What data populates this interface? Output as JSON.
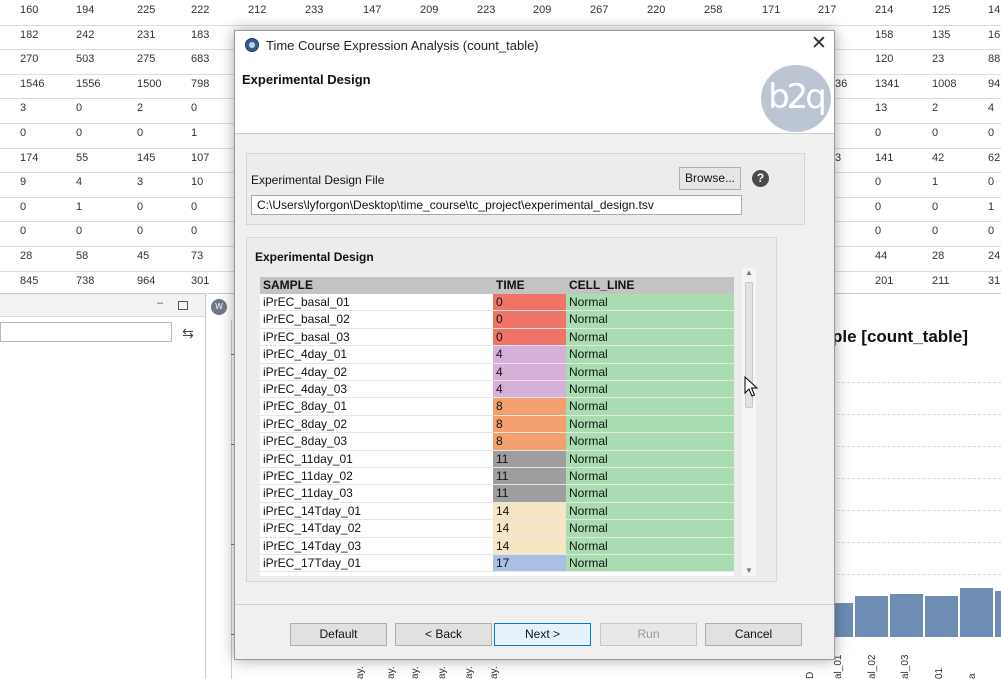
{
  "background_table": {
    "rows": [
      [
        "160",
        "194",
        "225",
        "222",
        "212",
        "233",
        "147",
        "209",
        "223",
        "209",
        "267",
        "220",
        "258",
        "171",
        "217",
        "",
        "214",
        "125",
        "14"
      ],
      [
        "182",
        "242",
        "231",
        "183",
        "",
        "",
        "",
        "",
        "",
        "",
        "",
        "",
        "",
        "",
        "",
        "",
        "158",
        "135",
        "16"
      ],
      [
        "270",
        "503",
        "275",
        "683",
        "",
        "",
        "",
        "",
        "",
        "",
        "",
        "",
        "",
        "",
        "",
        "",
        "120",
        "23",
        "88"
      ],
      [
        "1546",
        "1556",
        "1500",
        "798",
        "",
        "",
        "",
        "",
        "",
        "",
        "",
        "",
        "",
        "",
        "",
        "36",
        "1341",
        "1008",
        "94"
      ],
      [
        "3",
        "0",
        "2",
        "0",
        "",
        "",
        "",
        "",
        "",
        "",
        "",
        "",
        "",
        "",
        "",
        "",
        "13",
        "2",
        "4"
      ],
      [
        "0",
        "0",
        "0",
        "1",
        "",
        "",
        "",
        "",
        "",
        "",
        "",
        "",
        "",
        "",
        "",
        "",
        "0",
        "0",
        "0"
      ],
      [
        "174",
        "55",
        "145",
        "107",
        "",
        "",
        "",
        "",
        "",
        "",
        "",
        "",
        "",
        "",
        "",
        "3",
        "141",
        "42",
        "62"
      ],
      [
        "9",
        "4",
        "3",
        "10",
        "",
        "",
        "",
        "",
        "",
        "",
        "",
        "",
        "",
        "",
        "",
        "",
        "0",
        "1",
        "0"
      ],
      [
        "0",
        "1",
        "0",
        "0",
        "",
        "",
        "",
        "",
        "",
        "",
        "",
        "",
        "",
        "",
        "",
        "",
        "0",
        "0",
        "1"
      ],
      [
        "0",
        "0",
        "0",
        "0",
        "",
        "",
        "",
        "",
        "",
        "",
        "",
        "",
        "",
        "",
        "",
        "",
        "0",
        "0",
        "0"
      ],
      [
        "28",
        "58",
        "45",
        "73",
        "",
        "",
        "",
        "",
        "",
        "",
        "",
        "",
        "",
        "",
        "",
        "",
        "44",
        "28",
        "24"
      ],
      [
        "845",
        "738",
        "964",
        "301",
        "",
        "",
        "",
        "",
        "",
        "",
        "",
        "",
        "",
        "",
        "",
        "",
        "201",
        "211",
        "31"
      ]
    ]
  },
  "left_panel": {
    "minimize_glyph": "–"
  },
  "chart_panel": {
    "tab_icon_text": "W",
    "title_fragment": "ple [count_table]",
    "bar_color": "#6d8db5",
    "bars": [
      0.45,
      0.55,
      0.58,
      0.55,
      0.66,
      0.62
    ],
    "x_labels": [
      "ay.",
      "ay.",
      "ay.",
      "ay.",
      "ay.",
      "ay.",
      "D",
      "al_01",
      "al_02",
      "al_03",
      "01",
      "a"
    ]
  },
  "dialog": {
    "title": "Time Course Expression Analysis (count_table)",
    "close_glyph": "✕",
    "header_title": "Experimental Design",
    "logo_text": "b2q",
    "file_section": {
      "label": "Experimental Design File",
      "browse_label": "Browse...",
      "help_glyph": "?",
      "path_value": "C:\\Users\\lyforgon\\Desktop\\time_course\\tc_project\\experimental_design.tsv"
    },
    "design_section": {
      "label": "Experimental Design",
      "columns": [
        "SAMPLE",
        "TIME",
        "CELL_LINE"
      ],
      "rows": [
        {
          "sample": "iPrEC_basal_01",
          "time": "0",
          "cell_line": "Normal",
          "time_color": "#f07368"
        },
        {
          "sample": "iPrEC_basal_02",
          "time": "0",
          "cell_line": "Normal",
          "time_color": "#f07368"
        },
        {
          "sample": "iPrEC_basal_03",
          "time": "0",
          "cell_line": "Normal",
          "time_color": "#f07368"
        },
        {
          "sample": "iPrEC_4day_01",
          "time": "4",
          "cell_line": "Normal",
          "time_color": "#d7b0da"
        },
        {
          "sample": "iPrEC_4day_02",
          "time": "4",
          "cell_line": "Normal",
          "time_color": "#d7b0da"
        },
        {
          "sample": "iPrEC_4day_03",
          "time": "4",
          "cell_line": "Normal",
          "time_color": "#d7b0da"
        },
        {
          "sample": "iPrEC_8day_01",
          "time": "8",
          "cell_line": "Normal",
          "time_color": "#f4a06e"
        },
        {
          "sample": "iPrEC_8day_02",
          "time": "8",
          "cell_line": "Normal",
          "time_color": "#f4a06e"
        },
        {
          "sample": "iPrEC_8day_03",
          "time": "8",
          "cell_line": "Normal",
          "time_color": "#f4a06e"
        },
        {
          "sample": "iPrEC_11day_01",
          "time": "11",
          "cell_line": "Normal",
          "time_color": "#9e9e9e"
        },
        {
          "sample": "iPrEC_11day_02",
          "time": "11",
          "cell_line": "Normal",
          "time_color": "#9e9e9e"
        },
        {
          "sample": "iPrEC_11day_03",
          "time": "11",
          "cell_line": "Normal",
          "time_color": "#9e9e9e"
        },
        {
          "sample": "iPrEC_14Tday_01",
          "time": "14",
          "cell_line": "Normal",
          "time_color": "#f7e6c4"
        },
        {
          "sample": "iPrEC_14Tday_02",
          "time": "14",
          "cell_line": "Normal",
          "time_color": "#f7e6c4"
        },
        {
          "sample": "iPrEC_14Tday_03",
          "time": "14",
          "cell_line": "Normal",
          "time_color": "#f7e6c4"
        },
        {
          "sample": "iPrEC_17Tday_01",
          "time": "17",
          "cell_line": "Normal",
          "time_color": "#a9bfe3"
        }
      ],
      "cell_line_color": "#a9dcb0"
    },
    "buttons": {
      "default": "Default",
      "back": "< Back",
      "next": "Next >",
      "run": "Run",
      "cancel": "Cancel"
    }
  }
}
